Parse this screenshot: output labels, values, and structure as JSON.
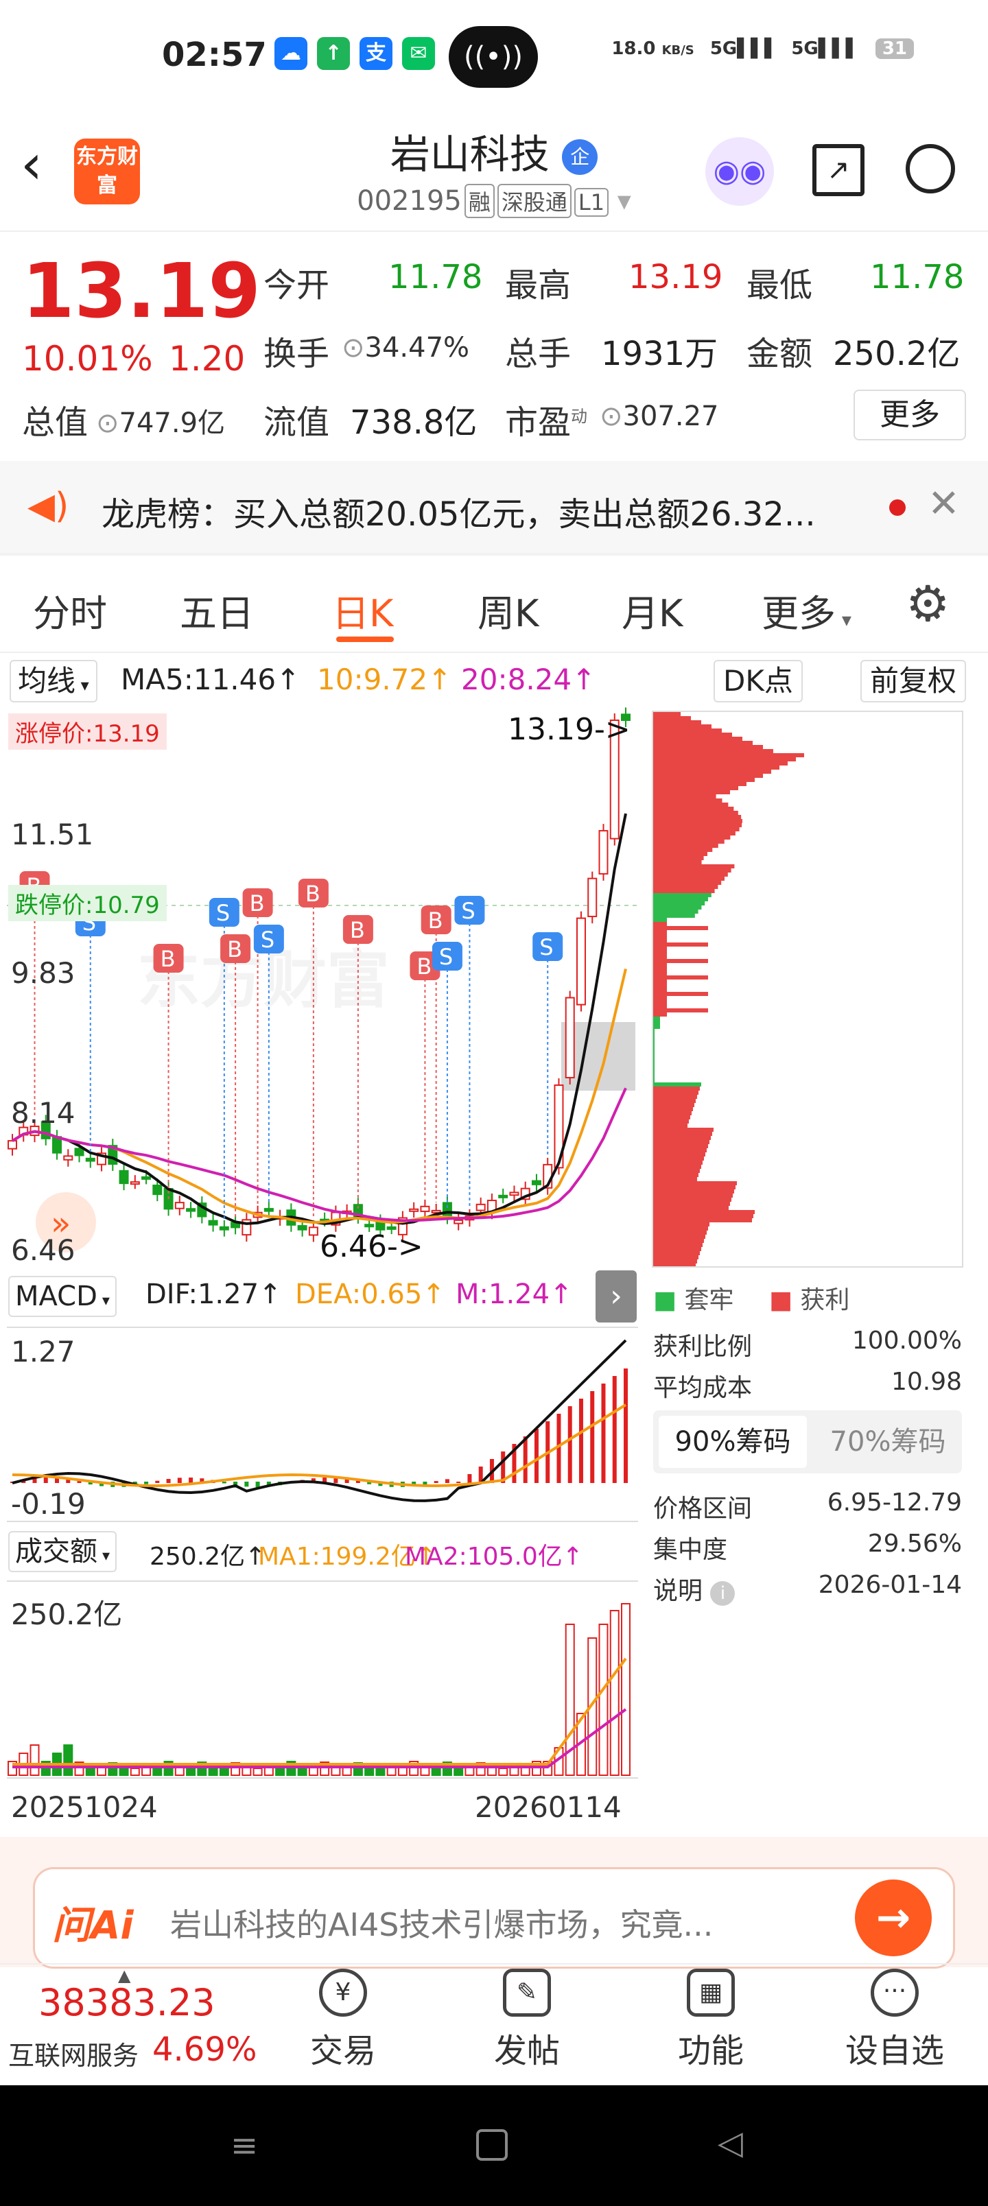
{
  "status_bar": {
    "time": "02:57",
    "net_speed": "18.0",
    "net_unit": "KB/S",
    "sig1": "5G",
    "sig2": "5G",
    "battery": "31"
  },
  "header": {
    "back_icon": "back-arrow-icon",
    "logo": "东方财富",
    "title": "岩山科技",
    "title_badge": "企",
    "code": "002195",
    "tags": [
      "融",
      "深股通",
      "L1"
    ],
    "share_icon": "share-icon",
    "search_icon": "search-icon"
  },
  "quote": {
    "price": "13.19",
    "change_pct": "10.01%",
    "change": "1.20",
    "open_label": "今开",
    "open": "11.78",
    "high_label": "最高",
    "high": "13.19",
    "low_label": "最低",
    "low": "11.78",
    "turnover_label": "换手",
    "turnover": "34.47%",
    "volume_label": "总手",
    "volume": "1931万",
    "amount_label": "金额",
    "amount": "250.2亿",
    "mcap_label": "总值",
    "mcap": "747.9亿",
    "float_label": "流值",
    "float": "738.8亿",
    "pe_label": "市盈",
    "pe_sup": "动",
    "pe": "307.27",
    "more_button": "更多"
  },
  "dragon_tiger": {
    "text": "龙虎榜：买入总额20.05亿元，卖出总额26.32..."
  },
  "tabs": [
    "分时",
    "五日",
    "日K",
    "周K",
    "月K",
    "更多"
  ],
  "active_tab": "日K",
  "ma_bar": {
    "selector": "均线",
    "ma5": "MA5:11.46↑",
    "ma10": "10:9.72↑",
    "ma20": "20:8.24↑",
    "dk": "DK点",
    "adjust": "前复权"
  },
  "kline": {
    "limit_up": "涨停价:13.19",
    "limit_down": "跌停价:10.79",
    "last_marker": "13.19->",
    "low_marker": "6.46->",
    "y_labels": [
      "11.51",
      "9.83",
      "8.14",
      "6.46"
    ],
    "watermark": "东方财富"
  },
  "macd_bar": {
    "selector": "MACD",
    "dif": "DIF:1.27↑",
    "dea": "DEA:0.65↑",
    "m": "M:1.24↑",
    "top": "1.27",
    "bottom": "-0.19"
  },
  "volume_bar": {
    "selector": "成交额",
    "value": "250.2亿↑",
    "ma1": "MA1:199.2亿↑",
    "ma2": "MA2:105.0亿↑",
    "top": "250.2亿",
    "date_start": "20251024",
    "date_end": "20260114"
  },
  "chips": {
    "legend_trapped": "套牢",
    "legend_profit": "获利",
    "rows": [
      {
        "label": "获利比例",
        "value": "100.00%"
      },
      {
        "label": "平均成本",
        "value": "10.98"
      }
    ],
    "tab90": "90%筹码",
    "tab70": "70%筹码",
    "rows2": [
      {
        "label": "价格区间",
        "value": "6.95-12.79"
      },
      {
        "label": "集中度",
        "value": "29.56%"
      },
      {
        "label": "说明",
        "value": "2026-01-14"
      }
    ]
  },
  "ai_bar": {
    "brand": "问Ai",
    "text": "岩山科技的AI4S技术引爆市场，究竟..."
  },
  "bottom_nav": {
    "index_value": "38383.23",
    "index_name": "互联网服务",
    "index_pct": "4.69%",
    "items": [
      "交易",
      "发帖",
      "功能",
      "设自选"
    ]
  },
  "colors": {
    "up": "#e02020",
    "down": "#15a020",
    "ma10": "#f39c12",
    "ma20": "#d020b0",
    "accent": "#ff5a1f"
  },
  "chart_data": {
    "type": "candlestick",
    "ylim": [
      6.46,
      13.19
    ],
    "series": [
      {
        "name": "MA5",
        "value": 11.46
      },
      {
        "name": "MA10",
        "value": 9.72
      },
      {
        "name": "MA20",
        "value": 8.24
      }
    ],
    "x_range": [
      "20251024",
      "20260114"
    ]
  }
}
